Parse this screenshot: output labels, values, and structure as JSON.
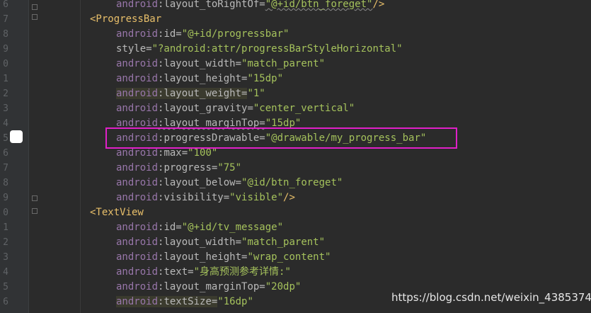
{
  "editor": {
    "lines": [
      {
        "num": "6",
        "parts": [
          {
            "t": "android",
            "c": "ns"
          },
          {
            "t": ":layout_toRightOf=",
            "c": "attr"
          },
          {
            "t": "\"@+id/btn_foreget\"",
            "c": "val"
          },
          {
            "t": "/>",
            "c": "tag"
          }
        ]
      },
      {
        "num": "7",
        "parts": [
          {
            "t": "<ProgressBar",
            "c": "tag"
          }
        ]
      },
      {
        "num": "8",
        "parts": [
          {
            "t": "android",
            "c": "ns"
          },
          {
            "t": ":id=",
            "c": "attr"
          },
          {
            "t": "\"@+id/progressbar\"",
            "c": "val"
          }
        ]
      },
      {
        "num": "9",
        "parts": [
          {
            "t": "style=",
            "c": "attr"
          },
          {
            "t": "\"?android:attr/progressBarStyleHorizontal\"",
            "c": "val"
          }
        ]
      },
      {
        "num": "0",
        "parts": [
          {
            "t": "android",
            "c": "ns"
          },
          {
            "t": ":layout_width=",
            "c": "attr"
          },
          {
            "t": "\"match_parent\"",
            "c": "val"
          }
        ]
      },
      {
        "num": "1",
        "parts": [
          {
            "t": "android",
            "c": "ns"
          },
          {
            "t": ":layout_height=",
            "c": "attr"
          },
          {
            "t": "\"15dp\"",
            "c": "val"
          }
        ]
      },
      {
        "num": "2",
        "parts": [
          {
            "t": "android",
            "c": "ns"
          },
          {
            "t": ":layout_weight=",
            "c": "attr"
          },
          {
            "t": "\"1\"",
            "c": "val"
          }
        ]
      },
      {
        "num": "3",
        "parts": [
          {
            "t": "android",
            "c": "ns"
          },
          {
            "t": ":layout_gravity=",
            "c": "attr"
          },
          {
            "t": "\"center_vertical\"",
            "c": "val"
          }
        ]
      },
      {
        "num": "4",
        "parts": [
          {
            "t": "android",
            "c": "ns"
          },
          {
            "t": ":layout_marginTop=",
            "c": "attr"
          },
          {
            "t": "\"15dp\"",
            "c": "val"
          }
        ]
      },
      {
        "num": "5",
        "parts": [
          {
            "t": "android",
            "c": "ns"
          },
          {
            "t": ":progressDrawable=",
            "c": "attr"
          },
          {
            "t": "\"@drawable/my_progress_bar\"",
            "c": "val"
          }
        ]
      },
      {
        "num": "6",
        "parts": [
          {
            "t": "android",
            "c": "ns"
          },
          {
            "t": ":max=",
            "c": "attr"
          },
          {
            "t": "\"100\"",
            "c": "val"
          }
        ]
      },
      {
        "num": "7",
        "parts": [
          {
            "t": "android",
            "c": "ns"
          },
          {
            "t": ":progress=",
            "c": "attr"
          },
          {
            "t": "\"75\"",
            "c": "val"
          }
        ]
      },
      {
        "num": "8",
        "parts": [
          {
            "t": "android",
            "c": "ns"
          },
          {
            "t": ":layout_below=",
            "c": "attr"
          },
          {
            "t": "\"@id/btn_foreget\"",
            "c": "val"
          }
        ]
      },
      {
        "num": "9",
        "parts": [
          {
            "t": "android",
            "c": "ns"
          },
          {
            "t": ":visibility=",
            "c": "attr"
          },
          {
            "t": "\"visible\"",
            "c": "val"
          },
          {
            "t": "/>",
            "c": "tag"
          }
        ]
      },
      {
        "num": "0",
        "parts": [
          {
            "t": "<TextView",
            "c": "tag"
          }
        ]
      },
      {
        "num": "1",
        "parts": [
          {
            "t": "android",
            "c": "ns"
          },
          {
            "t": ":id=",
            "c": "attr"
          },
          {
            "t": "\"@+id/tv_message\"",
            "c": "val"
          }
        ]
      },
      {
        "num": "2",
        "parts": [
          {
            "t": "android",
            "c": "ns"
          },
          {
            "t": ":layout_width=",
            "c": "attr"
          },
          {
            "t": "\"match_parent\"",
            "c": "val"
          }
        ]
      },
      {
        "num": "3",
        "parts": [
          {
            "t": "android",
            "c": "ns"
          },
          {
            "t": ":layout_height=",
            "c": "attr"
          },
          {
            "t": "\"wrap_content\"",
            "c": "val"
          }
        ]
      },
      {
        "num": "4",
        "parts": [
          {
            "t": "android",
            "c": "ns"
          },
          {
            "t": ":text=",
            "c": "attr"
          },
          {
            "t": "\"身高预测参考详情:\"",
            "c": "val"
          }
        ]
      },
      {
        "num": "5",
        "parts": [
          {
            "t": "android",
            "c": "ns"
          },
          {
            "t": ":layout_marginTop=",
            "c": "attr"
          },
          {
            "t": "\"20dp\"",
            "c": "val"
          }
        ]
      },
      {
        "num": "6",
        "parts": [
          {
            "t": "android",
            "c": "ns"
          },
          {
            "t": ":textSize=",
            "c": "attr"
          },
          {
            "t": "\"16dp\"",
            "c": "val"
          }
        ]
      }
    ]
  },
  "watermark": "https://blog.csdn.net/weixin_43853746"
}
